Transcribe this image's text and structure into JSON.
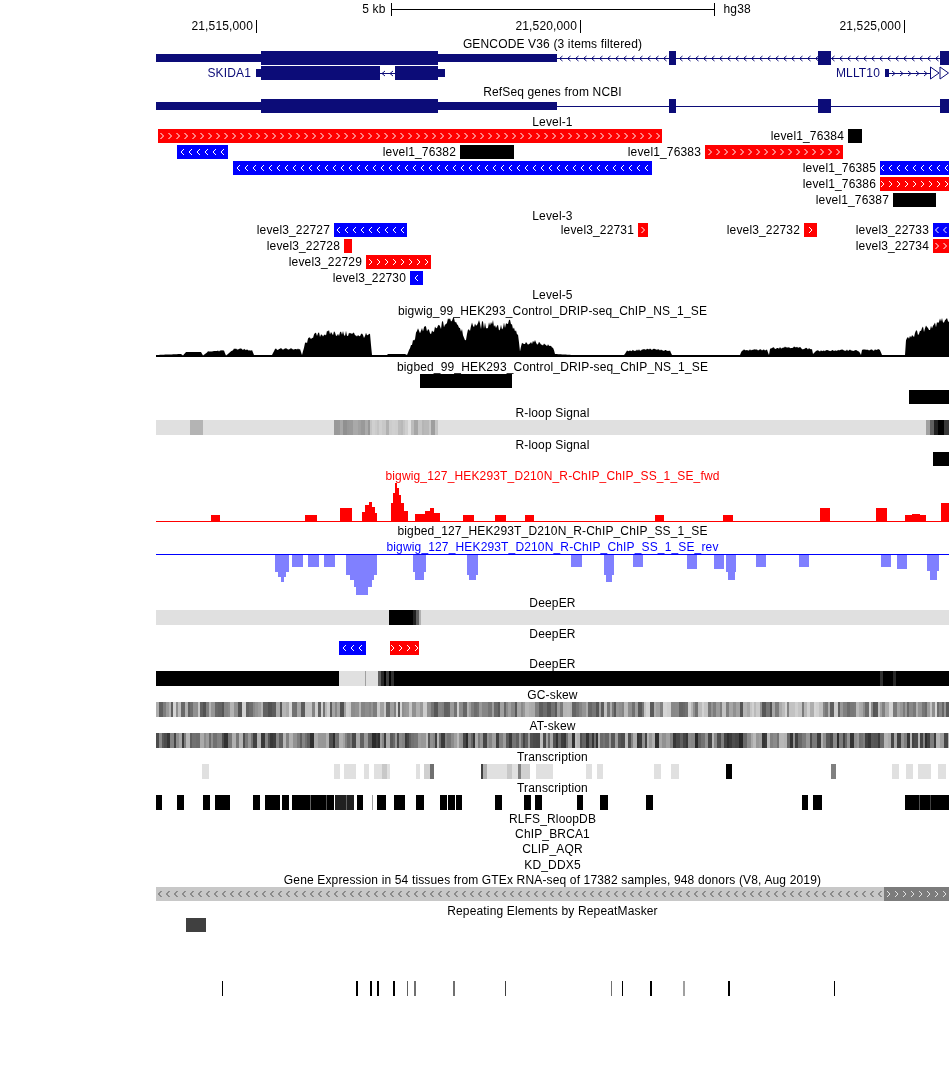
{
  "scale_bar": {
    "length": "5 kb",
    "assembly": "hg38"
  },
  "ruler": [
    "21,515,000",
    "21,520,000",
    "21,525,000"
  ],
  "tracks": [
    {
      "kind": "genes",
      "title": "GENCODE V36 (3 items filtered)",
      "genes": [
        {
          "kind": "minus"
        },
        {
          "name": "SKIDA1",
          "kind": "minus"
        },
        {
          "name": "MLLT10",
          "kind": "plus"
        }
      ]
    },
    {
      "kind": "genes",
      "title": "RefSeq genes from NCBI",
      "genes": [
        {
          "kind": "plain"
        }
      ]
    },
    {
      "kind": "features",
      "title": "Level-1",
      "features": [
        {
          "kind": "plus"
        },
        {
          "label": "level1_76384",
          "kind": "plain"
        },
        {
          "kind": "minus"
        },
        {
          "label": "level1_76382",
          "kind": "plain"
        },
        {
          "label": "level1_76383",
          "kind": "plus"
        },
        {
          "kind": "minus"
        },
        {
          "label": "level1_76385",
          "kind": "minus"
        },
        {
          "label": "level1_76386",
          "kind": "plus"
        },
        {
          "label": "level1_76387",
          "kind": "plain"
        }
      ]
    },
    {
      "kind": "features",
      "title": "Level-3",
      "features": [
        {
          "label": "level3_22727",
          "kind": "minus"
        },
        {
          "label": "level3_22731",
          "kind": "plus"
        },
        {
          "label": "level3_22732",
          "kind": "plus"
        },
        {
          "label": "level3_22733",
          "kind": "minus"
        },
        {
          "label": "level3_22728",
          "kind": "plus"
        },
        {
          "label": "level3_22734",
          "kind": "plus"
        },
        {
          "label": "level3_22729",
          "kind": "plus"
        },
        {
          "label": "level3_22730",
          "kind": "minus"
        }
      ]
    },
    {
      "kind": "header",
      "title": "Level-5"
    },
    {
      "kind": "signal",
      "title": "bigwig_99_HEK293_Control_DRIP-seq_ChIP_NS_1_SE",
      "color": "#000000"
    },
    {
      "kind": "features",
      "title": "bigbed_99_HEK293_Control_DRIP-seq_ChIP_NS_1_SE",
      "features": [
        {
          "kind": "plain"
        },
        {
          "kind": "plain"
        }
      ]
    },
    {
      "kind": "density",
      "title": "R-loop Signal"
    },
    {
      "kind": "features",
      "title": "R-loop Signal",
      "features": [
        {
          "kind": "plain"
        }
      ]
    },
    {
      "kind": "signal",
      "title": "bigwig_127_HEK293T_D210N_R-ChIP_ChIP_SS_1_SE_fwd",
      "color": "#ff0000"
    },
    {
      "kind": "header",
      "title": "bigbed_127_HEK293T_D210N_R-ChIP_ChIP_SS_1_SE"
    },
    {
      "kind": "signal-down",
      "title": "bigwig_127_HEK293T_D210N_R-ChIP_ChIP_SS_1_SE_rev",
      "color": "#0000ff"
    },
    {
      "kind": "density",
      "title": "DeepER"
    },
    {
      "kind": "features",
      "title": "DeepER",
      "features": [
        {
          "kind": "minus"
        },
        {
          "kind": "plus"
        }
      ]
    },
    {
      "kind": "density",
      "title": "DeepER"
    },
    {
      "kind": "density",
      "title": "GC-skew"
    },
    {
      "kind": "density",
      "title": "AT-skew"
    },
    {
      "kind": "density",
      "title": "Transcription"
    },
    {
      "kind": "density",
      "title": "Transcription"
    },
    {
      "kind": "header",
      "title": "RLFS_RloopDB"
    },
    {
      "kind": "header",
      "title": "ChIP_BRCA1"
    },
    {
      "kind": "header",
      "title": "CLIP_AQR"
    },
    {
      "kind": "header",
      "title": "KD_DDX5"
    },
    {
      "kind": "features",
      "title": "Gene Expression in 54 tissues from GTEx RNA-seq of 17382 samples, 948 donors (V8, Aug 2019)",
      "features": [
        {
          "kind": "minus",
          "color": "#c8c8c8"
        },
        {
          "kind": "plus",
          "color": "#7c7c7c"
        }
      ]
    },
    {
      "kind": "repeats",
      "title": "Repeating Elements by RepeatMasker"
    }
  ]
}
